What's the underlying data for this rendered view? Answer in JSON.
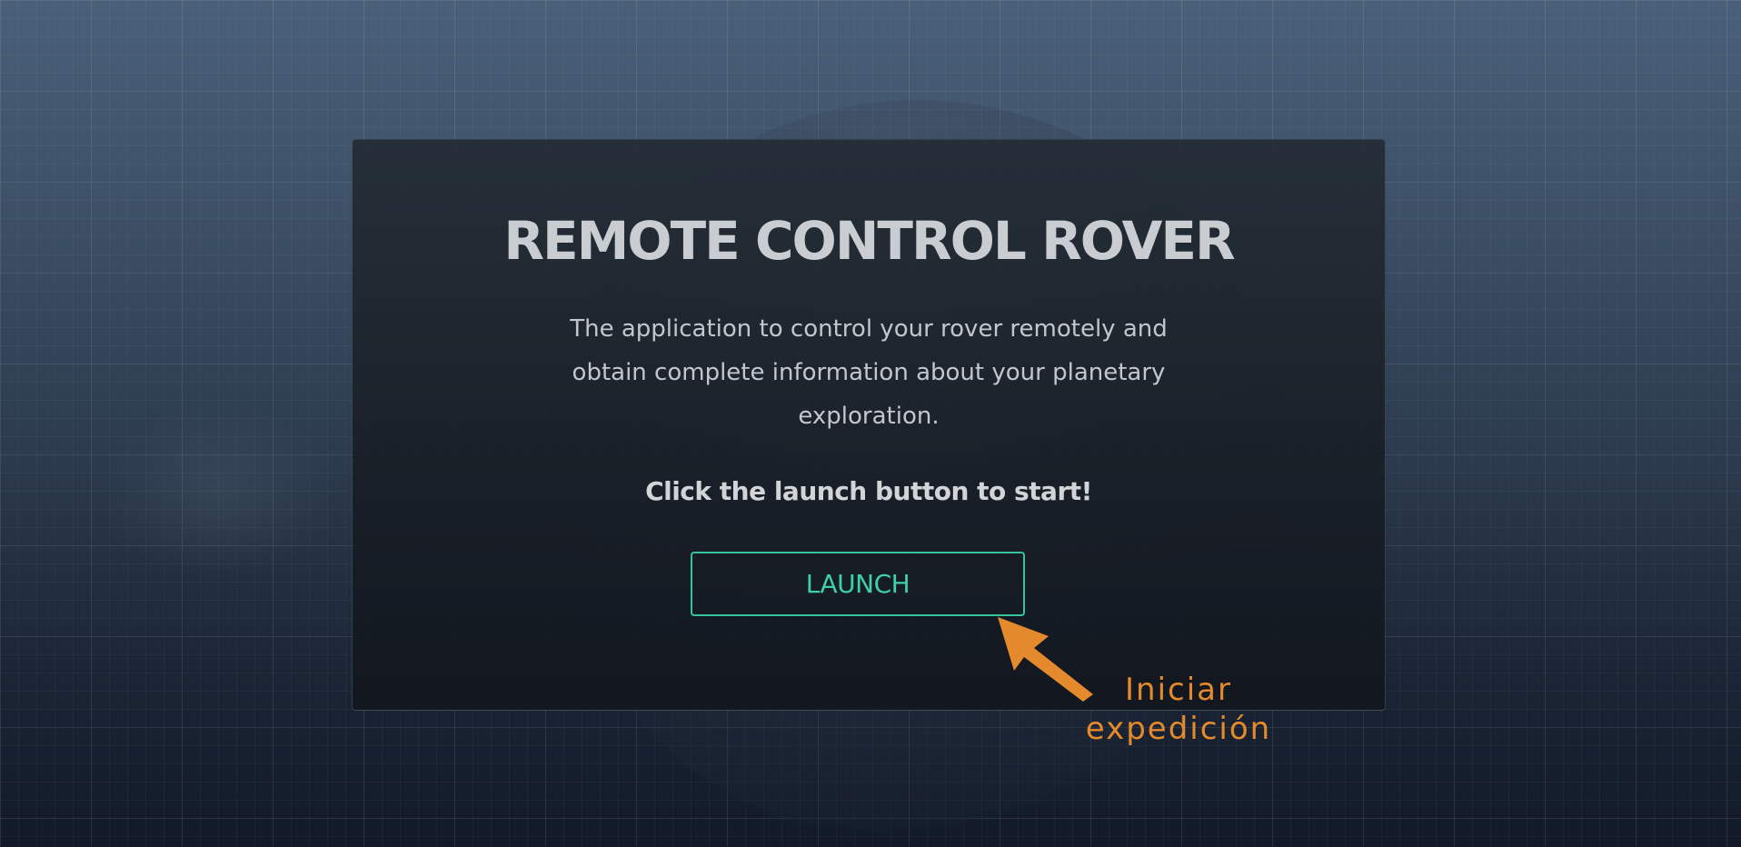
{
  "card": {
    "title": "REMOTE CONTROL ROVER",
    "description": "The application to control your rover remotely and obtain complete information about your planetary exploration.",
    "call_to_action": "Click the launch button to start!",
    "launch_label": "LAUNCH"
  },
  "annotation": {
    "line1": "Iniciar",
    "line2": "expedición",
    "arrow_icon": "arrow-pointing-up-left-icon"
  },
  "colors": {
    "accent_green": "#35c49a",
    "annotation_orange": "#e58a2c",
    "title_text": "#c9ccd0"
  }
}
